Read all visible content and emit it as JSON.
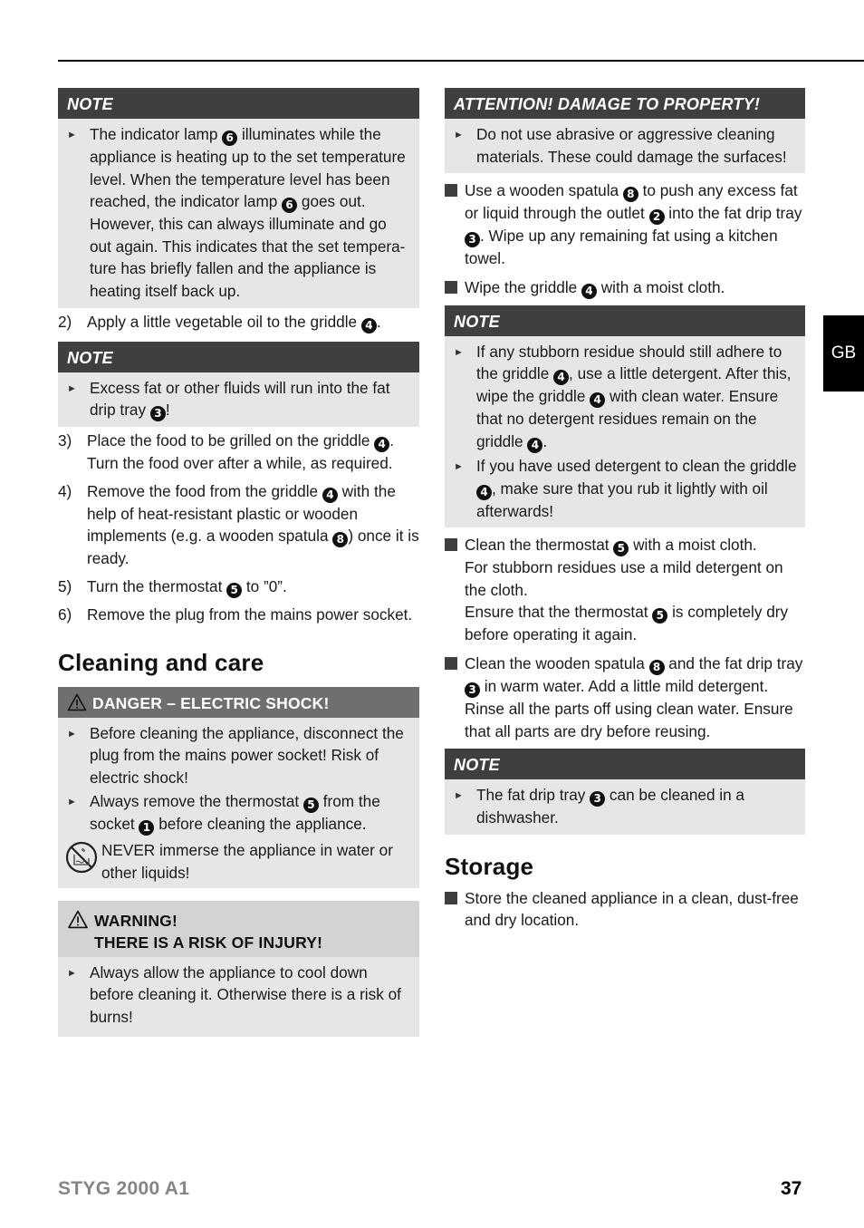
{
  "page": {
    "tab_label": "GB",
    "footer_model": "STYG 2000 A1",
    "page_number": "37"
  },
  "left": {
    "note1": {
      "title": "NOTE",
      "items": [
        [
          "The indicator lamp ",
          "6",
          " illuminates while the appliance is heating up to the set temperature level. When the temperature level has been reached, the indicator lamp ",
          "6",
          " goes out. However, this can always illuminate and go out again. This indicates that the set tempera-ture has briefly fallen and the appliance is heating itself back up."
        ]
      ]
    },
    "step2": {
      "num": "2)",
      "parts": [
        "Apply a little vegetable oil to the griddle ",
        "4",
        "."
      ]
    },
    "note2": {
      "title": "NOTE",
      "items": [
        [
          "Excess fat or other fluids will run into the fat drip tray ",
          "3",
          "!"
        ]
      ]
    },
    "steps": [
      {
        "num": "3)",
        "parts": [
          "Place the food to be grilled on the griddle ",
          "4",
          ". Turn the food over after a while, as required."
        ]
      },
      {
        "num": "4)",
        "parts": [
          "Remove the food from the griddle ",
          "4",
          " with the help of heat-resistant plastic or wooden implements (e.g. a wooden spatula ",
          "8",
          ") once it is ready."
        ]
      },
      {
        "num": "5)",
        "parts": [
          "Turn the thermostat ",
          "5",
          " to ”0”."
        ]
      },
      {
        "num": "6)",
        "parts": [
          "Remove the plug from the mains power socket."
        ]
      }
    ],
    "section_title": "Cleaning and care",
    "danger": {
      "title": "DANGER – ELECTRIC SHOCK!",
      "items": [
        [
          "Before cleaning the appliance, disconnect the plug from the mains power socket! Risk of electric shock!"
        ],
        [
          "Always remove the thermostat ",
          "5",
          " from the socket ",
          "1",
          " before cleaning the appliance."
        ]
      ],
      "no_immerse": "NEVER immerse the appliance in water or other liquids!"
    },
    "warning": {
      "title_line1": "WARNING!",
      "title_line2": "THERE IS A RISK OF INJURY!",
      "items": [
        [
          "Always allow the appliance to cool down before cleaning it. Otherwise there is a risk of burns!"
        ]
      ]
    }
  },
  "right": {
    "attention": {
      "title": "ATTENTION! DAMAGE TO PROPERTY!",
      "items": [
        [
          "Do not use abrasive or aggressive cleaning materials. These could damage the surfaces!"
        ]
      ]
    },
    "bullets1": [
      [
        "Use a wooden spatula ",
        "8",
        " to push any excess fat or liquid through the outlet ",
        "2",
        " into the fat drip tray ",
        "3",
        ". Wipe up any remaining fat using a kitchen towel."
      ],
      [
        "Wipe the griddle ",
        "4",
        " with a moist cloth."
      ]
    ],
    "note3": {
      "title": "NOTE",
      "items": [
        [
          "If any stubborn residue should still adhere to the griddle ",
          "4",
          ", use a little detergent. After this, wipe the griddle ",
          "4",
          " with clean water. Ensure that no detergent residues remain on the griddle ",
          "4",
          "."
        ],
        [
          "If you have used detergent to clean the griddle ",
          "4",
          ", make sure that you rub it lightly with oil afterwards!"
        ]
      ]
    },
    "bullets2": [
      [
        "Clean the thermostat ",
        "5",
        " with a moist cloth.\nFor stubborn residues use a mild detergent on the cloth.\nEnsure that the thermostat ",
        "5",
        " is completely dry before operating it again."
      ],
      [
        "Clean the wooden spatula ",
        "8",
        " and the fat drip tray ",
        "3",
        " in warm water. Add a little mild detergent.\nRinse all the parts off using clean water. Ensure that all parts are dry before reusing."
      ]
    ],
    "note4": {
      "title": "NOTE",
      "items": [
        [
          "The fat drip tray ",
          "3",
          " can be cleaned in a dishwasher."
        ]
      ]
    },
    "storage_title": "Storage",
    "storage_bullets": [
      [
        "Store the cleaned appliance in a clean, dust-free and dry location."
      ]
    ]
  }
}
